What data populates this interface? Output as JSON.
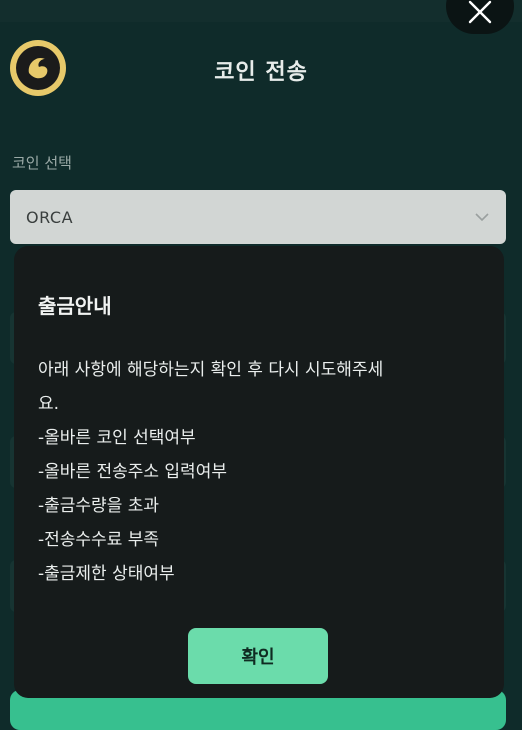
{
  "header": {
    "title": "코인 전송",
    "close_icon": "close-icon",
    "logo_icon": "orca-logo-icon"
  },
  "form": {
    "coin_label": "코인 선택",
    "coin_value": "ORCA",
    "dropdown_icon": "chevron-down-icon"
  },
  "modal": {
    "title": "출금안내",
    "lines": [
      "아래 사항에 해당하는지 확인 후 다시 시도해주세",
      "요.",
      "-올바른 코인 선택여부",
      "-올바른 전송주소 입력여부",
      "-출금수량을 초과",
      "-전송수수료 부족",
      "-출금제한 상태여부"
    ],
    "confirm_label": "확인"
  },
  "colors": {
    "background": "#0f2b2a",
    "modal_bg": "#161b1b",
    "accent": "#6bdcab",
    "select_bg": "#d2d6d4"
  }
}
